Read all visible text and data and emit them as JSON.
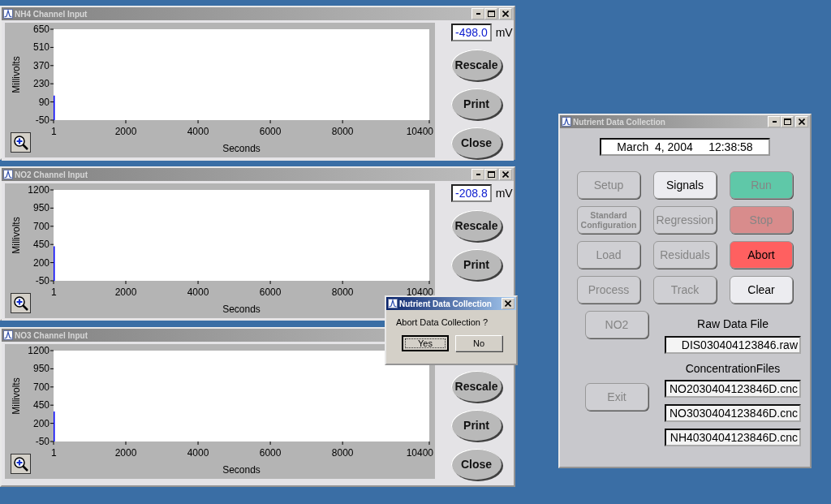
{
  "channel_windows": [
    {
      "title": "NH4 Channel Input",
      "window_controls": true,
      "readout": {
        "value": "-498.0",
        "unit": "mV"
      },
      "buttons": [
        "Rescale",
        "Print",
        "Close"
      ],
      "chart_data": {
        "type": "line",
        "ylabel": "Millivolts",
        "xlabel": "Seconds",
        "xlim": [
          1,
          10400
        ],
        "ylim": [
          -50,
          650
        ],
        "xticks": [
          1,
          2000,
          4000,
          6000,
          8000,
          10400
        ],
        "yticks": [
          -50,
          90,
          230,
          370,
          510,
          650
        ]
      }
    },
    {
      "title": "NO2 Channel Input",
      "window_controls": true,
      "readout": {
        "value": "-208.8",
        "unit": "mV"
      },
      "buttons": [
        "Rescale",
        "Print"
      ],
      "chart_data": {
        "type": "line",
        "ylabel": "Millivolts",
        "xlabel": "Seconds",
        "xlim": [
          1,
          10400
        ],
        "ylim": [
          -50,
          1200
        ],
        "xticks": [
          1,
          2000,
          4000,
          6000,
          8000,
          10400
        ],
        "yticks": [
          -50,
          200,
          450,
          700,
          950,
          1200
        ]
      }
    },
    {
      "title": "NO3 Channel Input",
      "buttons": [
        "Rescale",
        "Print",
        "Close"
      ],
      "chart_data": {
        "type": "line",
        "ylabel": "Millivolts",
        "xlabel": "Seconds",
        "xlim": [
          1,
          10400
        ],
        "ylim": [
          -50,
          1200
        ],
        "xticks": [
          1,
          2000,
          4000,
          6000,
          8000,
          10400
        ],
        "yticks": [
          -50,
          200,
          450,
          700,
          950,
          1200
        ]
      }
    }
  ],
  "main_window": {
    "title": "Nutrient Data Collection",
    "datetime": "March  4, 2004     12:38:58",
    "buttons": [
      {
        "label": "Setup",
        "kind": "normal",
        "disabled": true
      },
      {
        "label": "Signals",
        "kind": "normal",
        "disabled": false
      },
      {
        "label": "Run",
        "kind": "normal",
        "disabled": true,
        "color": "#5fc8a8"
      },
      {
        "label": "Standard Configuration",
        "kind": "small",
        "disabled": true
      },
      {
        "label": "Regression",
        "kind": "normal",
        "disabled": true
      },
      {
        "label": "Stop",
        "kind": "normal",
        "disabled": true,
        "color": "#d88c8c"
      },
      {
        "label": "Load",
        "kind": "normal",
        "disabled": true
      },
      {
        "label": "Residuals",
        "kind": "normal",
        "disabled": true
      },
      {
        "label": "Abort",
        "kind": "normal",
        "disabled": false,
        "color": "#ff6060"
      },
      {
        "label": "Process",
        "kind": "normal",
        "disabled": true
      },
      {
        "label": "Track",
        "kind": "normal",
        "disabled": true
      },
      {
        "label": "Clear",
        "kind": "normal",
        "disabled": false
      }
    ],
    "lower_buttons": [
      {
        "label": "NO2",
        "disabled": true
      },
      {
        "label": "Exit",
        "disabled": true
      }
    ],
    "raw_data_file": {
      "label": "Raw Data File",
      "value": "DIS030404123846.raw"
    },
    "concentration_files": {
      "label": "ConcentrationFiles",
      "values": [
        "NO2030404123846D.cnc",
        "NO3030404123846D.cnc",
        "NH4030404123846D.cnc"
      ]
    }
  },
  "dialog": {
    "title": "Nutrient Data Collection",
    "message": "Abort Data Collection ?",
    "buttons": [
      {
        "label": "Yes",
        "selected": true
      },
      {
        "label": "No",
        "selected": false
      }
    ]
  }
}
